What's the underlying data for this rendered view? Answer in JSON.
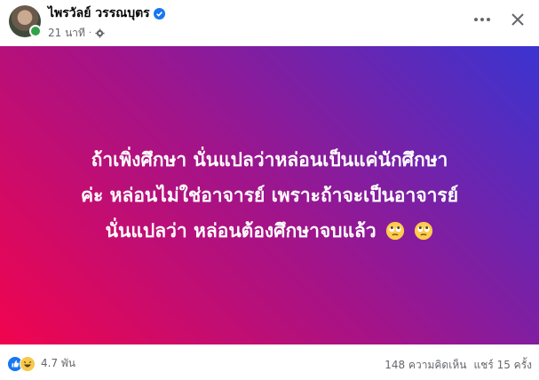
{
  "header": {
    "author_name": "ไพรวัลย์ วรรณบุตร",
    "timestamp": "21 นาที",
    "verified_color": "#1877f2"
  },
  "post": {
    "lines": [
      "ถ้าเพิ่งศึกษา นั่นแปลว่าหล่อนเป็นแค่นักศึกษา",
      "ค่ะ หล่อนไม่ใช่อาจารย์ เพราะถ้าจะเป็นอาจารย์",
      "นั่นแปลว่า หล่อนต้องศึกษาจบแล้ว"
    ],
    "emoji": "face-with-rolling-eyes",
    "gradient": [
      "#f1044e",
      "#a2148a",
      "#3a34d1"
    ]
  },
  "footer": {
    "reaction_count": "4.7 พัน",
    "comments": "148 ความคิดเห็น",
    "shares": "แชร์ 15 ครั้ง"
  }
}
